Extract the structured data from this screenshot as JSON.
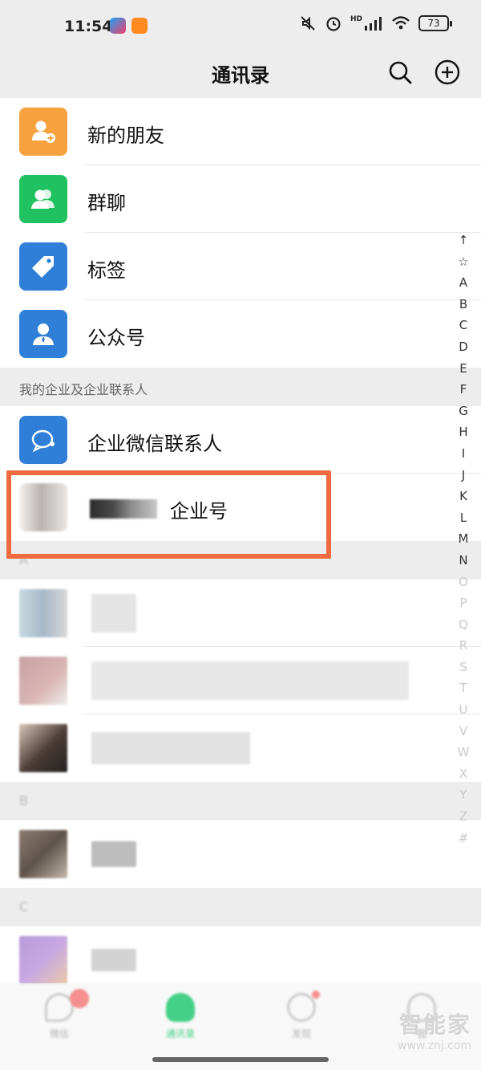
{
  "status_bar": {
    "time": "11:54",
    "battery": "73",
    "network": "HD",
    "icons": [
      "app-icon-youku",
      "app-icon-didi",
      "mute-icon",
      "alarm-icon",
      "signal-icon",
      "wifi-icon",
      "battery-icon"
    ]
  },
  "header": {
    "title": "通讯录",
    "search_icon": "search-icon",
    "add_icon": "plus-circle-icon"
  },
  "contacts_menu": [
    {
      "label": "新的朋友",
      "icon": "add-friend-icon",
      "color": "#f7a23e"
    },
    {
      "label": "群聊",
      "icon": "group-chat-icon",
      "color": "#1fc160"
    },
    {
      "label": "标签",
      "icon": "tag-icon",
      "color": "#2f7fd8"
    },
    {
      "label": "公众号",
      "icon": "official-account-icon",
      "color": "#2f7fd8"
    }
  ],
  "enterprise_section": {
    "title": "我的企业及企业联系人",
    "items": [
      {
        "label": "企业微信联系人",
        "icon": "wecom-contacts-icon",
        "color": "#2f7fd8"
      },
      {
        "label": "企业号",
        "icon": "enterprise-avatar-icon"
      }
    ]
  },
  "alpha_sections": [
    "A",
    "B",
    "C"
  ],
  "alphabet_index": [
    "↑",
    "☆",
    "A",
    "B",
    "C",
    "D",
    "E",
    "F",
    "G",
    "H",
    "I",
    "J",
    "K",
    "L",
    "M",
    "N",
    "O",
    "P",
    "Q",
    "R",
    "S",
    "T",
    "U",
    "V",
    "W",
    "X",
    "Y",
    "Z",
    "#"
  ],
  "tabbar": {
    "items": [
      {
        "label": "微信",
        "icon": "chat-icon"
      },
      {
        "label": "通讯录",
        "icon": "contacts-icon"
      },
      {
        "label": "发现",
        "icon": "discover-icon"
      },
      {
        "label": "我",
        "icon": "me-icon"
      }
    ]
  },
  "watermark": {
    "text": "智能家",
    "url": "www.znj.com"
  },
  "colors": {
    "header_bg": "#ededed",
    "accent_green": "#07c160",
    "highlight_border": "#f06a3f"
  }
}
